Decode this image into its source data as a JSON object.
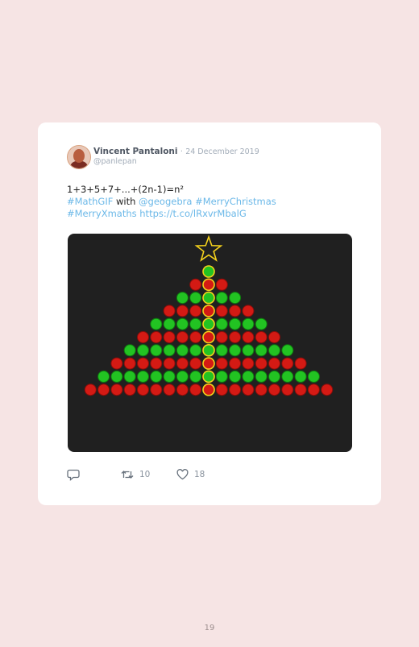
{
  "tweet": {
    "author_name": "Vincent Pantaloni",
    "separator": "·",
    "date": "24 December 2019",
    "handle": "@panlepan",
    "line1": "1+3+5+7+...+(2n-1)=n²",
    "hashtag_mathgif": "#MathGIF",
    "with_text": " with ",
    "mention_geogebra": "@geogebra",
    "hashtag_merrychristmas": " #MerryChristmas",
    "hashtag_merryxmaths": "#MerryXmaths",
    "short_link": " https://t.co/lRxvrMbalG"
  },
  "media": {
    "description_icon": "christmas-tree-dots",
    "rows": 10,
    "colors": {
      "green": "#22c322",
      "red": "#d41a14",
      "star": "#f5d21c",
      "center_outline": "#f5d21c",
      "background": "#202020"
    }
  },
  "actions": {
    "reply_icon": "reply-icon",
    "retweet_icon": "retweet-icon",
    "retweet_count": "10",
    "like_icon": "heart-icon",
    "like_count": "18"
  },
  "page_number": "19"
}
